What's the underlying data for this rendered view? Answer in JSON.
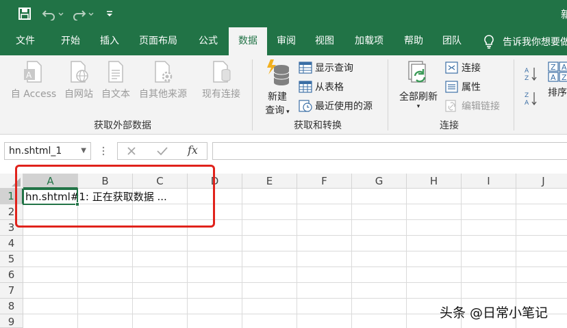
{
  "titlebar": {
    "doc_title": "新"
  },
  "tabs": [
    {
      "label": "文件"
    },
    {
      "label": "开始"
    },
    {
      "label": "插入"
    },
    {
      "label": "页面布局"
    },
    {
      "label": "公式"
    },
    {
      "label": "数据",
      "active": true
    },
    {
      "label": "审阅"
    },
    {
      "label": "视图"
    },
    {
      "label": "加载项"
    },
    {
      "label": "帮助"
    },
    {
      "label": "团队"
    }
  ],
  "tellme": {
    "label": "告诉我你想要做"
  },
  "ribbon": {
    "get_external": {
      "group_label": "获取外部数据",
      "from_access": "自 Access",
      "from_web": "自网站",
      "from_text": "自文本",
      "from_other": "自其他来源",
      "existing_connections": "现有连接"
    },
    "get_transform": {
      "group_label": "获取和转换",
      "new_query_line1": "新建",
      "new_query_line2": "查询",
      "show_queries": "显示查询",
      "from_table": "从表格",
      "recent_sources": "最近使用的源"
    },
    "connections": {
      "group_label": "连接",
      "refresh_all": "全部刷新",
      "connections": "连接",
      "properties": "属性",
      "edit_links": "编辑链接"
    },
    "sort": {
      "sort_label": "排序"
    }
  },
  "formula_bar": {
    "name_box": "hn.shtml_1",
    "fx": "fx",
    "formula_value": ""
  },
  "grid": {
    "columns": [
      "A",
      "B",
      "C",
      "D",
      "E",
      "F",
      "G",
      "H",
      "I",
      "J"
    ],
    "rows": [
      "1",
      "2",
      "3",
      "4",
      "5",
      "6",
      "7",
      "8",
      "9"
    ],
    "selected_column": "A",
    "selected_row": "1",
    "cell_a1": "hn.shtml#1: 正在获取数据 ..."
  },
  "watermark": "头条 @日常小笔记",
  "colors": {
    "excel_green": "#217346",
    "annotation_red": "#e0221b"
  }
}
